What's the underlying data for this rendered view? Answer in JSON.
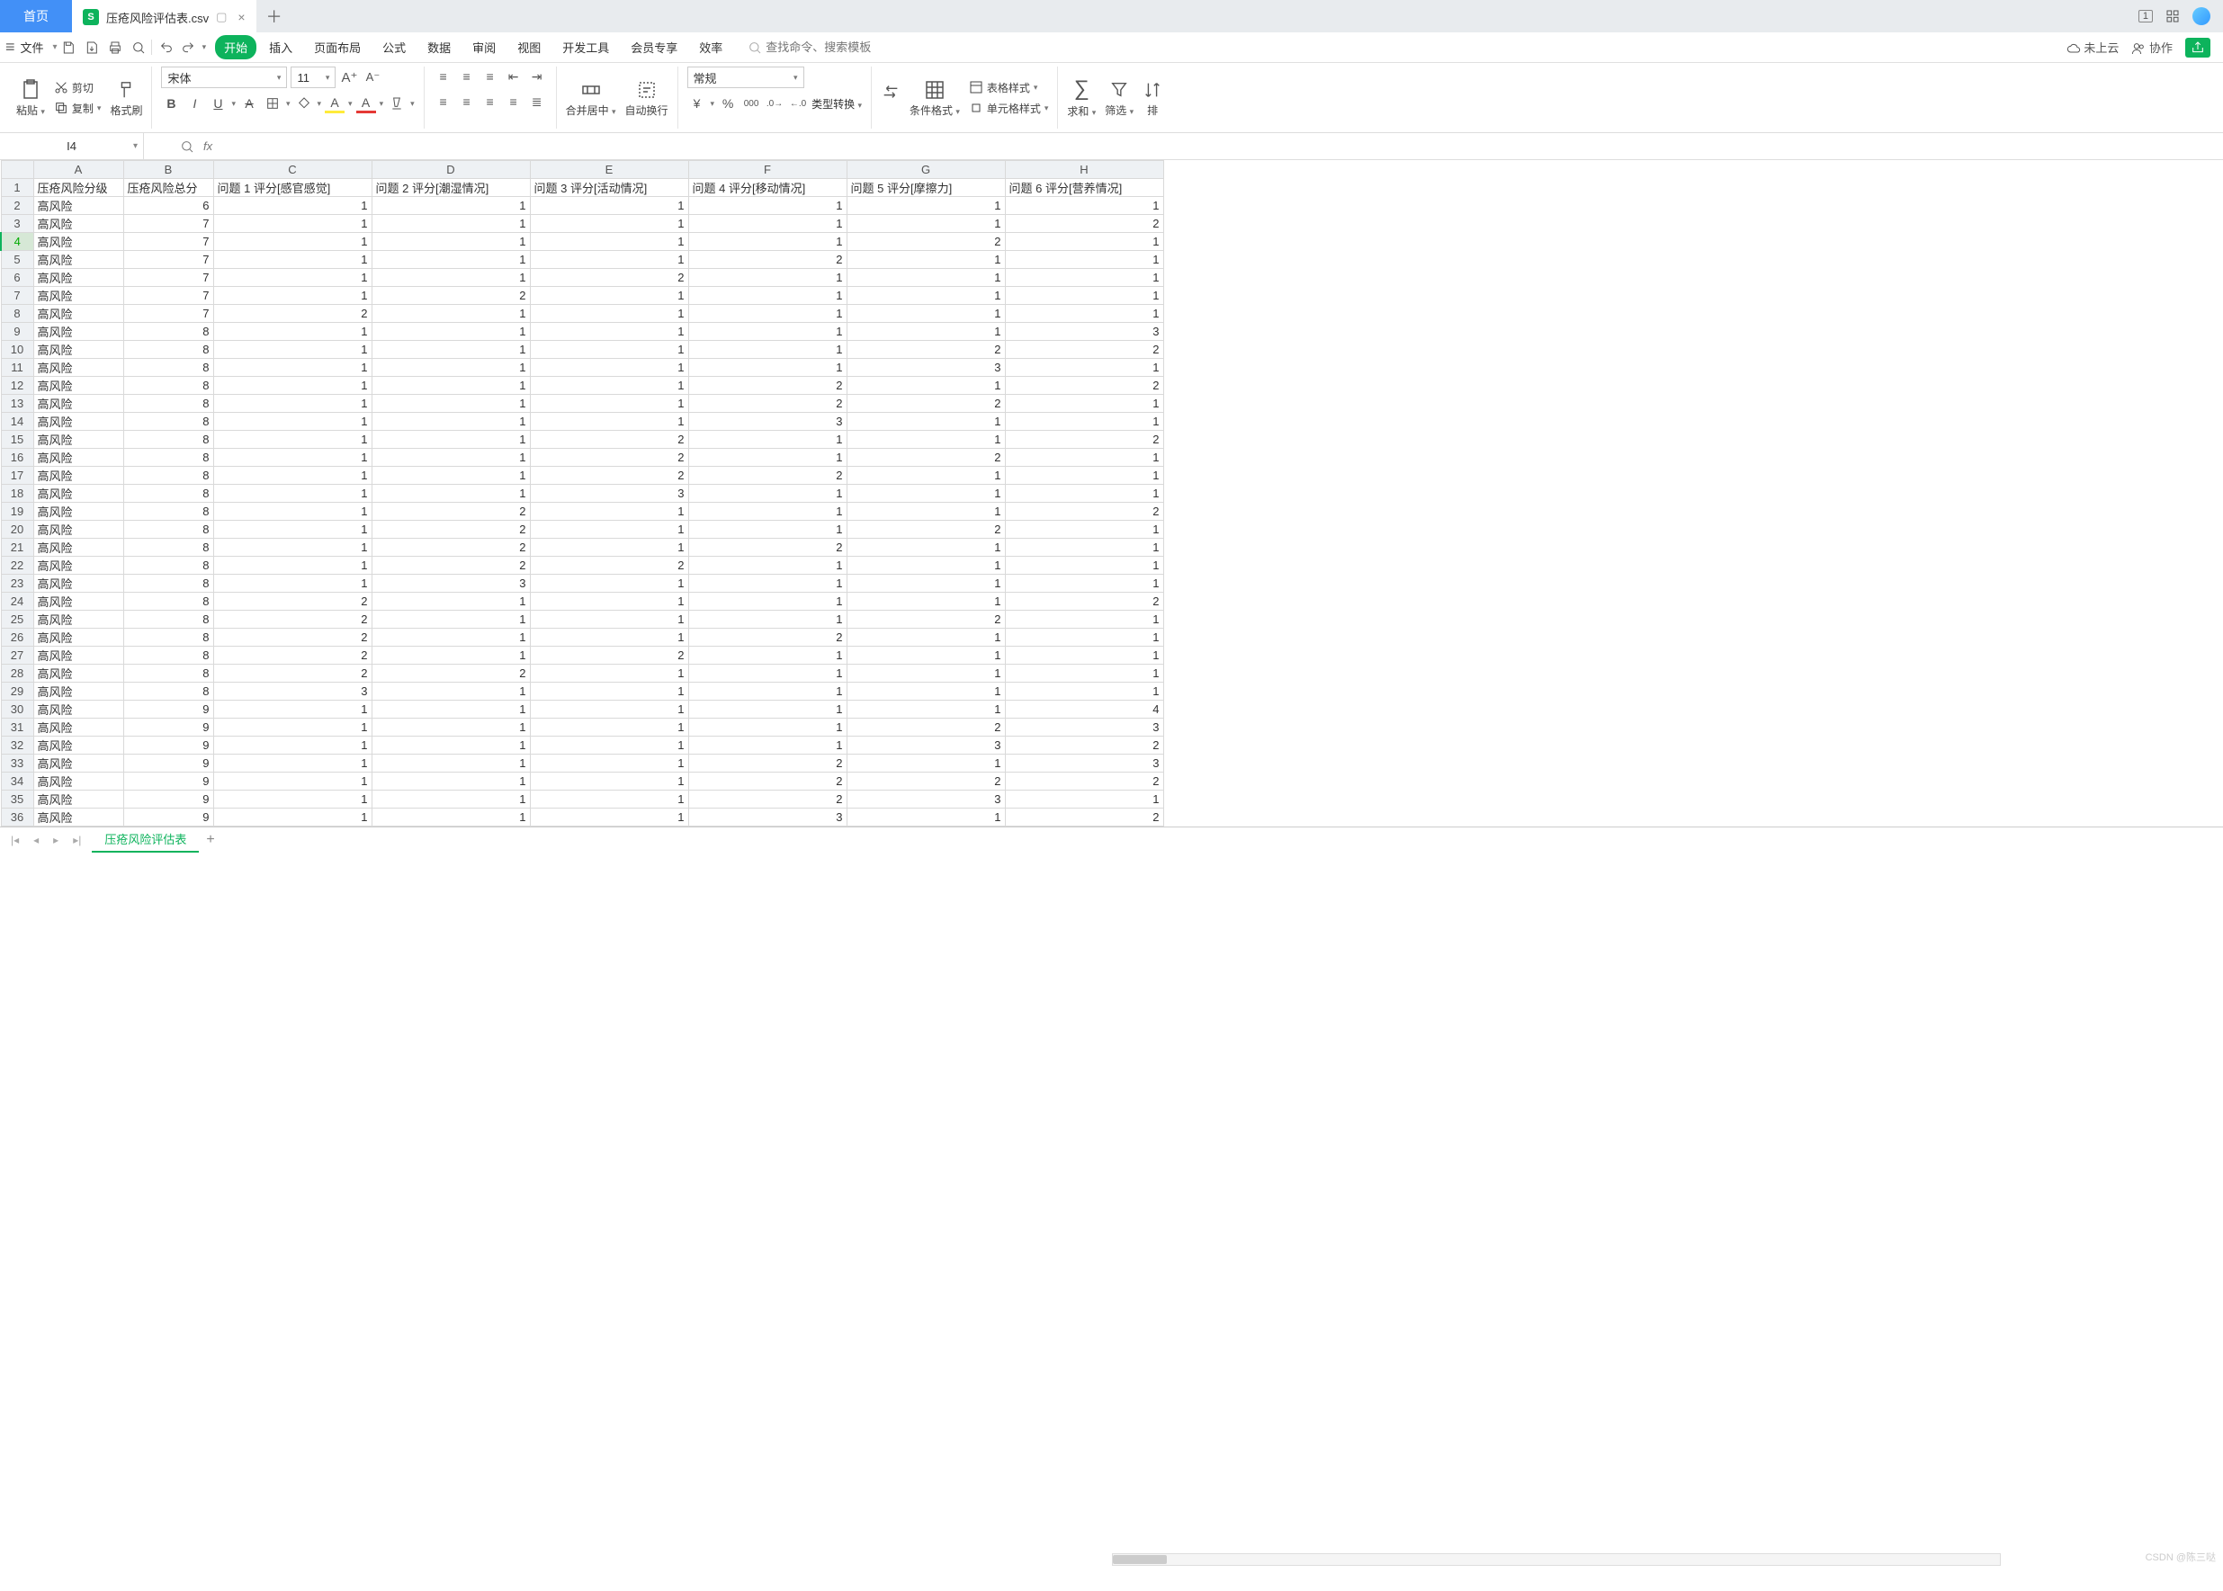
{
  "titlebar": {
    "home_tab": "首页",
    "file_tab": "压疮风险评估表.csv",
    "file_icon": "S",
    "new_tab": "＋"
  },
  "menubar": {
    "file_label": "文件",
    "tabs": [
      "开始",
      "插入",
      "页面布局",
      "公式",
      "数据",
      "审阅",
      "视图",
      "开发工具",
      "会员专享",
      "效率"
    ],
    "search_placeholder": "查找命令、搜索模板",
    "cloud": "未上云",
    "coop": "协作"
  },
  "ribbon": {
    "paste": "粘贴",
    "cut": "剪切",
    "copy": "复制",
    "fmtpaint": "格式刷",
    "font_name": "宋体",
    "font_size": "11",
    "merge": "合并居中",
    "wrap": "自动换行",
    "num_fmt": "常规",
    "type_conv": "类型转换",
    "cond_fmt": "条件格式",
    "table_style": "表格样式",
    "cell_style": "单元格样式",
    "sum": "求和",
    "filter": "筛选",
    "sort": "排"
  },
  "namebox": "I4",
  "columns": [
    "A",
    "B",
    "C",
    "D",
    "E",
    "F",
    "G",
    "H"
  ],
  "headers": [
    "压疮风险分级",
    "压疮风险总分",
    "问题 1 评分[感官感觉]",
    "问题 2 评分[潮湿情况]",
    "问题 3 评分[活动情况]",
    "问题 4 评分[移动情况]",
    "问题 5 评分[摩擦力]",
    "问题 6 评分[营养情况]"
  ],
  "active_row": 4,
  "rows": [
    {
      "r": 2,
      "a": "高风险",
      "b": "6",
      "c": "1",
      "d": "1",
      "e": "1",
      "f": "1",
      "g": "1",
      "h": "1"
    },
    {
      "r": 3,
      "a": "高风险",
      "b": "7",
      "c": "1",
      "d": "1",
      "e": "1",
      "f": "1",
      "g": "1",
      "h": "2"
    },
    {
      "r": 4,
      "a": "高风险",
      "b": "7",
      "c": "1",
      "d": "1",
      "e": "1",
      "f": "1",
      "g": "2",
      "h": "1"
    },
    {
      "r": 5,
      "a": "高风险",
      "b": "7",
      "c": "1",
      "d": "1",
      "e": "1",
      "f": "2",
      "g": "1",
      "h": "1"
    },
    {
      "r": 6,
      "a": "高风险",
      "b": "7",
      "c": "1",
      "d": "1",
      "e": "2",
      "f": "1",
      "g": "1",
      "h": "1"
    },
    {
      "r": 7,
      "a": "高风险",
      "b": "7",
      "c": "1",
      "d": "2",
      "e": "1",
      "f": "1",
      "g": "1",
      "h": "1"
    },
    {
      "r": 8,
      "a": "高风险",
      "b": "7",
      "c": "2",
      "d": "1",
      "e": "1",
      "f": "1",
      "g": "1",
      "h": "1"
    },
    {
      "r": 9,
      "a": "高风险",
      "b": "8",
      "c": "1",
      "d": "1",
      "e": "1",
      "f": "1",
      "g": "1",
      "h": "3"
    },
    {
      "r": 10,
      "a": "高风险",
      "b": "8",
      "c": "1",
      "d": "1",
      "e": "1",
      "f": "1",
      "g": "2",
      "h": "2"
    },
    {
      "r": 11,
      "a": "高风险",
      "b": "8",
      "c": "1",
      "d": "1",
      "e": "1",
      "f": "1",
      "g": "3",
      "h": "1"
    },
    {
      "r": 12,
      "a": "高风险",
      "b": "8",
      "c": "1",
      "d": "1",
      "e": "1",
      "f": "2",
      "g": "1",
      "h": "2"
    },
    {
      "r": 13,
      "a": "高风险",
      "b": "8",
      "c": "1",
      "d": "1",
      "e": "1",
      "f": "2",
      "g": "2",
      "h": "1"
    },
    {
      "r": 14,
      "a": "高风险",
      "b": "8",
      "c": "1",
      "d": "1",
      "e": "1",
      "f": "3",
      "g": "1",
      "h": "1"
    },
    {
      "r": 15,
      "a": "高风险",
      "b": "8",
      "c": "1",
      "d": "1",
      "e": "2",
      "f": "1",
      "g": "1",
      "h": "2"
    },
    {
      "r": 16,
      "a": "高风险",
      "b": "8",
      "c": "1",
      "d": "1",
      "e": "2",
      "f": "1",
      "g": "2",
      "h": "1"
    },
    {
      "r": 17,
      "a": "高风险",
      "b": "8",
      "c": "1",
      "d": "1",
      "e": "2",
      "f": "2",
      "g": "1",
      "h": "1"
    },
    {
      "r": 18,
      "a": "高风险",
      "b": "8",
      "c": "1",
      "d": "1",
      "e": "3",
      "f": "1",
      "g": "1",
      "h": "1"
    },
    {
      "r": 19,
      "a": "高风险",
      "b": "8",
      "c": "1",
      "d": "2",
      "e": "1",
      "f": "1",
      "g": "1",
      "h": "2"
    },
    {
      "r": 20,
      "a": "高风险",
      "b": "8",
      "c": "1",
      "d": "2",
      "e": "1",
      "f": "1",
      "g": "2",
      "h": "1"
    },
    {
      "r": 21,
      "a": "高风险",
      "b": "8",
      "c": "1",
      "d": "2",
      "e": "1",
      "f": "2",
      "g": "1",
      "h": "1"
    },
    {
      "r": 22,
      "a": "高风险",
      "b": "8",
      "c": "1",
      "d": "2",
      "e": "2",
      "f": "1",
      "g": "1",
      "h": "1"
    },
    {
      "r": 23,
      "a": "高风险",
      "b": "8",
      "c": "1",
      "d": "3",
      "e": "1",
      "f": "1",
      "g": "1",
      "h": "1"
    },
    {
      "r": 24,
      "a": "高风险",
      "b": "8",
      "c": "2",
      "d": "1",
      "e": "1",
      "f": "1",
      "g": "1",
      "h": "2"
    },
    {
      "r": 25,
      "a": "高风险",
      "b": "8",
      "c": "2",
      "d": "1",
      "e": "1",
      "f": "1",
      "g": "2",
      "h": "1"
    },
    {
      "r": 26,
      "a": "高风险",
      "b": "8",
      "c": "2",
      "d": "1",
      "e": "1",
      "f": "2",
      "g": "1",
      "h": "1"
    },
    {
      "r": 27,
      "a": "高风险",
      "b": "8",
      "c": "2",
      "d": "1",
      "e": "2",
      "f": "1",
      "g": "1",
      "h": "1"
    },
    {
      "r": 28,
      "a": "高风险",
      "b": "8",
      "c": "2",
      "d": "2",
      "e": "1",
      "f": "1",
      "g": "1",
      "h": "1"
    },
    {
      "r": 29,
      "a": "高风险",
      "b": "8",
      "c": "3",
      "d": "1",
      "e": "1",
      "f": "1",
      "g": "1",
      "h": "1"
    },
    {
      "r": 30,
      "a": "高风险",
      "b": "9",
      "c": "1",
      "d": "1",
      "e": "1",
      "f": "1",
      "g": "1",
      "h": "4"
    },
    {
      "r": 31,
      "a": "高风险",
      "b": "9",
      "c": "1",
      "d": "1",
      "e": "1",
      "f": "1",
      "g": "2",
      "h": "3"
    },
    {
      "r": 32,
      "a": "高风险",
      "b": "9",
      "c": "1",
      "d": "1",
      "e": "1",
      "f": "1",
      "g": "3",
      "h": "2"
    },
    {
      "r": 33,
      "a": "高风险",
      "b": "9",
      "c": "1",
      "d": "1",
      "e": "1",
      "f": "2",
      "g": "1",
      "h": "3"
    },
    {
      "r": 34,
      "a": "高风险",
      "b": "9",
      "c": "1",
      "d": "1",
      "e": "1",
      "f": "2",
      "g": "2",
      "h": "2"
    },
    {
      "r": 35,
      "a": "高风险",
      "b": "9",
      "c": "1",
      "d": "1",
      "e": "1",
      "f": "2",
      "g": "3",
      "h": "1"
    },
    {
      "r": 36,
      "a": "高风险",
      "b": "9",
      "c": "1",
      "d": "1",
      "e": "1",
      "f": "3",
      "g": "1",
      "h": "2"
    }
  ],
  "sheet_tab": "压疮风险评估表",
  "watermark": "CSDN @陈三哒"
}
